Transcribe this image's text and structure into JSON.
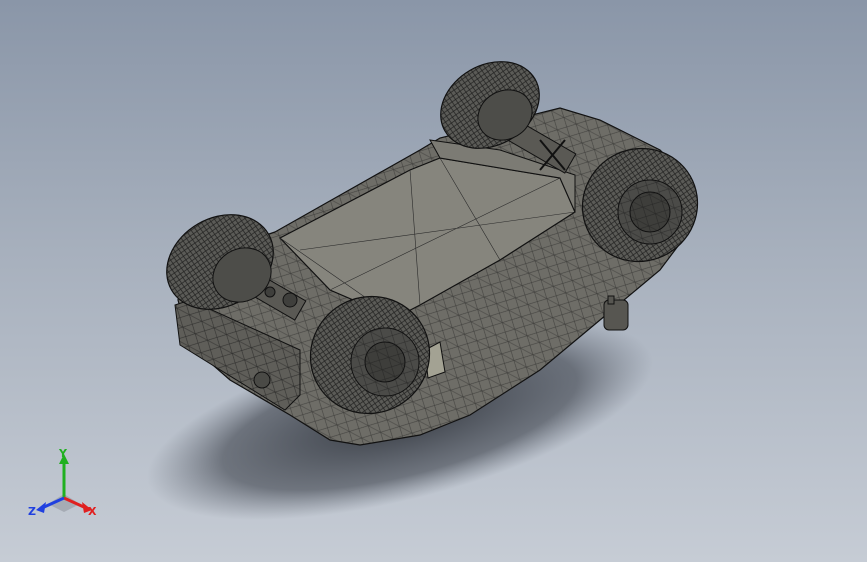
{
  "viewport": {
    "background_top": "#8a96a8",
    "background_bottom": "#c6ccd5"
  },
  "model": {
    "body_color": "#6f6e68",
    "top_face_color": "#86857d",
    "mesh_line_color": "#111111",
    "tire_color": "#5b5b57"
  },
  "triad": {
    "x_label": "X",
    "y_label": "Y",
    "z_label": "Z",
    "x_color": "#e02020",
    "y_color": "#20b020",
    "z_color": "#2040e0"
  }
}
